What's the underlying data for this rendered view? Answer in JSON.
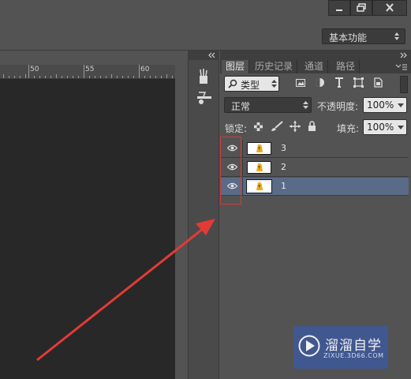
{
  "window_controls": {
    "minimize_icon": "minimize-icon",
    "restore_icon": "restore-icon",
    "close_icon": "close-icon"
  },
  "options_bar": {
    "workspace_label": "基本功能"
  },
  "ruler": {
    "labels": [
      "50",
      "55",
      "60"
    ]
  },
  "layers_panel": {
    "tabs": [
      "图层",
      "历史记录",
      "通道",
      "路径"
    ],
    "active_tab": "图层",
    "filter": {
      "label": "类型",
      "icons": [
        "image-filter-icon",
        "adjustment-filter-icon",
        "text-filter-icon",
        "shape-filter-icon",
        "smart-object-filter-icon"
      ]
    },
    "blend_mode": "正常",
    "opacity_label": "不透明度:",
    "opacity_value": "100%",
    "lock_label": "锁定:",
    "fill_label": "填充:",
    "fill_value": "100%",
    "layers": [
      {
        "name": "3",
        "visible": true,
        "selected": false
      },
      {
        "name": "2",
        "visible": true,
        "selected": false
      },
      {
        "name": "1",
        "visible": true,
        "selected": true
      }
    ]
  },
  "annotation": {
    "highlight_color": "#d13a3a",
    "arrow_color": "#e23b36"
  },
  "watermark": {
    "title": "溜溜自学",
    "url": "ZIXUE.3D66.COM"
  }
}
